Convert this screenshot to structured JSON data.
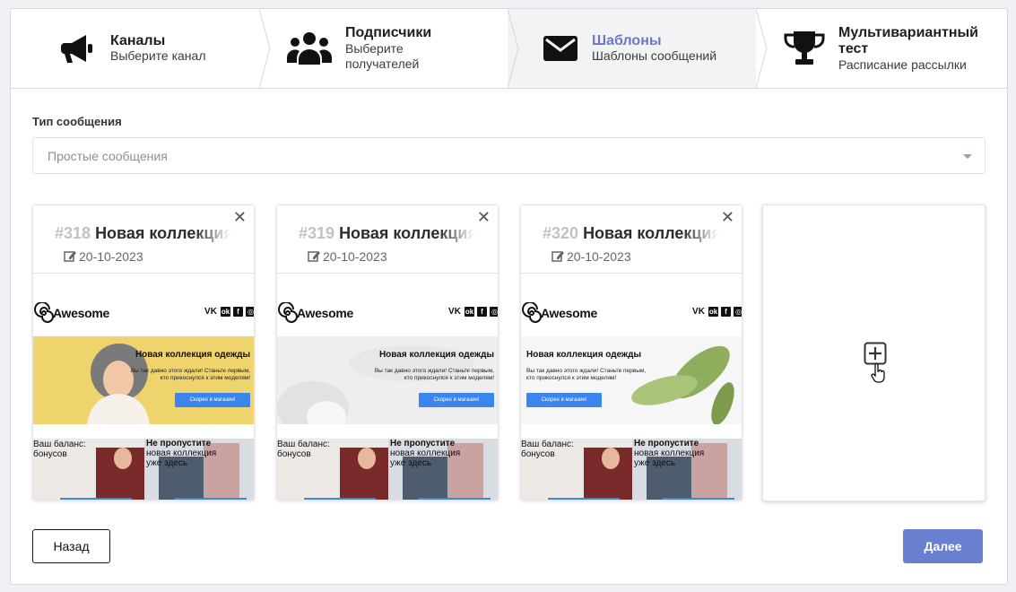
{
  "steps": [
    {
      "title": "Каналы",
      "subtitle": "Выберите канал",
      "icon": "megaphone-icon"
    },
    {
      "title": "Подписчики",
      "subtitle": "Выберите получателей",
      "subtitle_lines": [
        "Выберите",
        "получателей"
      ],
      "icon": "users-icon"
    },
    {
      "title": "Шаблоны",
      "subtitle": "Шаблоны сообщений",
      "icon": "envelope-icon",
      "active": true
    },
    {
      "title": "Мультивариантный тест",
      "title_lines": [
        "Мультивариантный",
        "тест"
      ],
      "subtitle": "Расписание рассылки",
      "icon": "trophy-icon"
    }
  ],
  "message_type": {
    "label": "Тип сообщения",
    "value": "Простые сообщения"
  },
  "templates": [
    {
      "number": "#318",
      "name": "Новая коллекция",
      "date": "20-10-2023",
      "preview": {
        "logo": "Awesome",
        "hero_title": "Новая коллекция одежды",
        "hero_text": "Вы так давно этого ждали! Станьте первым, кто прикоснулся к этим моделям!",
        "hero_button": "Скорее в магазин!",
        "bottom_left": "Ваш баланс: бонусов",
        "bottom_right_title": "Не пропустите",
        "bottom_right_text": "новая коллекция уже здесь",
        "theme": "yellow"
      }
    },
    {
      "number": "#319",
      "name": "Новая коллекция",
      "date": "20-10-2023",
      "preview": {
        "logo": "Awesome",
        "hero_title": "Новая коллекция одежды",
        "hero_text": "Вы так давно этого ждали! Станьте первым, кто прикоснулся к этим моделям!",
        "hero_button": "Скорее в магазин!",
        "bottom_left": "Ваш баланс: бонусов",
        "bottom_right_title": "Не пропустите",
        "bottom_right_text": "новая коллекция уже здесь",
        "theme": "white"
      }
    },
    {
      "number": "#320",
      "name": "Новая коллекция",
      "date": "20-10-2023",
      "preview": {
        "logo": "Awesome",
        "hero_title": "Новая коллекция одежды",
        "hero_text": "Вы так давно этого ждали! Станьте первым, кто прикоснулся к этим моделям!",
        "hero_button": "Скорее в магазин!",
        "bottom_left": "Ваш баланс: бонусов",
        "bottom_right_title": "Не пропустите",
        "bottom_right_text": "новая коллекция уже здесь",
        "theme": "plant"
      }
    }
  ],
  "buttons": {
    "back": "Назад",
    "next": "Далее"
  },
  "colors": {
    "accent": "#6b7fd1",
    "active_step_title": "#6b78c9",
    "hero_button": "#3a86ee"
  }
}
